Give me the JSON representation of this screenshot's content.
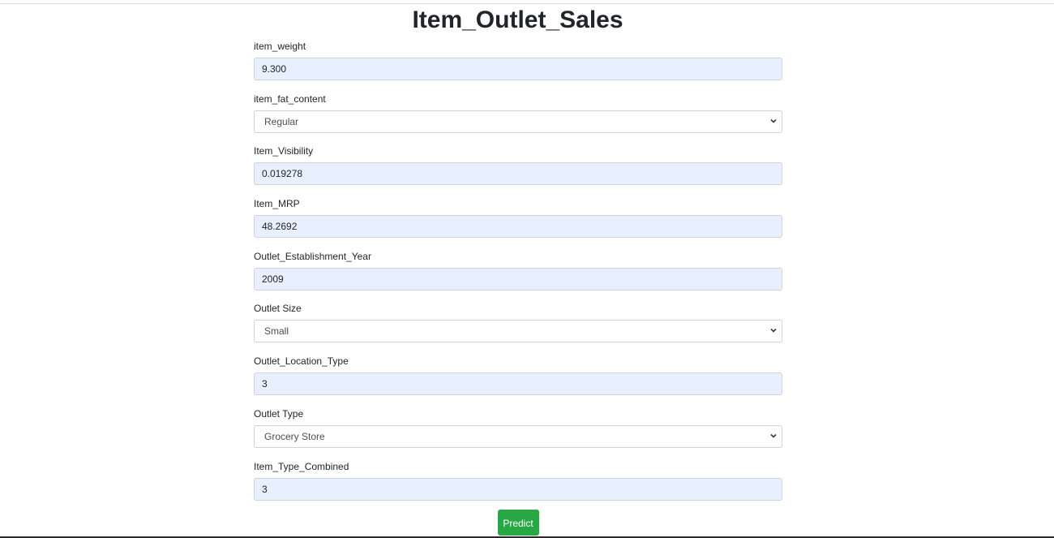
{
  "page": {
    "title": "Item_Outlet_Sales"
  },
  "form": {
    "fields": [
      {
        "label": "item_weight",
        "type": "input",
        "value": "9.300"
      },
      {
        "label": "item_fat_content",
        "type": "select",
        "value": "Regular"
      },
      {
        "label": "Item_Visibility",
        "type": "input",
        "value": "0.019278"
      },
      {
        "label": "Item_MRP",
        "type": "input",
        "value": "48.2692"
      },
      {
        "label": "Outlet_Establishment_Year",
        "type": "input",
        "value": "2009"
      },
      {
        "label": "Outlet Size",
        "type": "select",
        "value": "Small"
      },
      {
        "label": "Outlet_Location_Type",
        "type": "input",
        "value": "3"
      },
      {
        "label": "Outlet Type",
        "type": "select",
        "value": "Grocery Store"
      },
      {
        "label": "Item_Type_Combined",
        "type": "input",
        "value": "3"
      }
    ],
    "submit_label": "Predict"
  },
  "colors": {
    "autofill_bg": "#e8f0fe",
    "button_bg": "#28a745",
    "button_text": "#ffffff",
    "border": "#ced4da"
  },
  "icons": {
    "select_arrow": "chevron-down-icon"
  }
}
